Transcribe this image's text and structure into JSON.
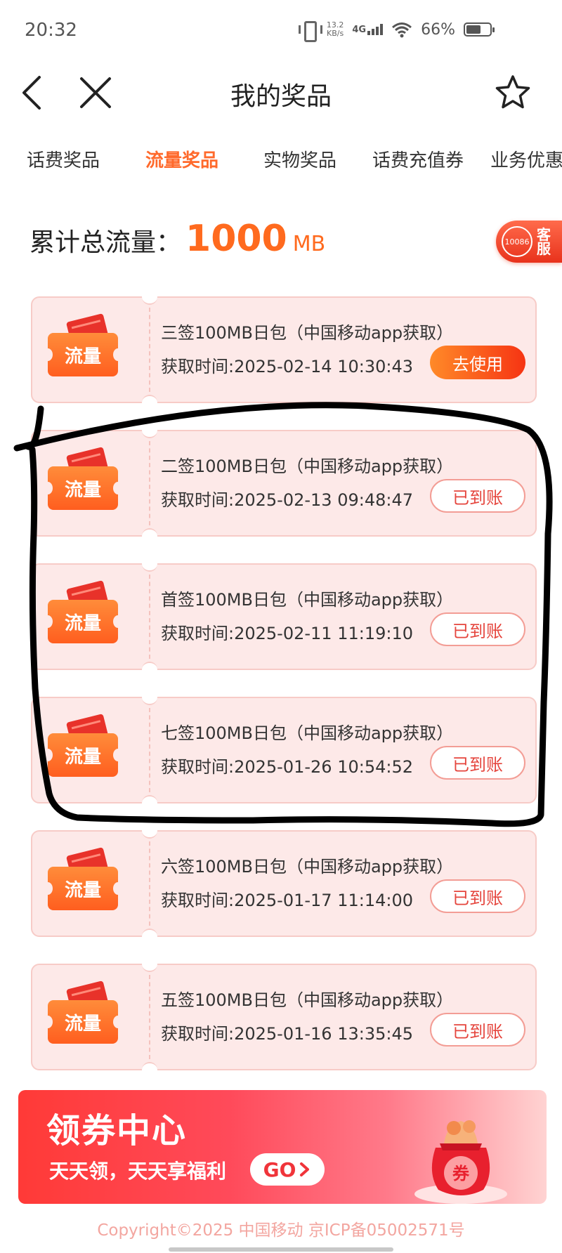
{
  "status_bar": {
    "time": "20:32",
    "net_speed_value": "13.2",
    "net_speed_unit": "KB/s",
    "network": "4G",
    "battery": "66%",
    "battery_level": 0.66
  },
  "header": {
    "title": "我的奖品",
    "back_icon": "chevron-left-icon",
    "close_icon": "close-icon",
    "favorite_icon": "star-icon"
  },
  "tabs": [
    {
      "label": "话费奖品",
      "active": false
    },
    {
      "label": "流量奖品",
      "active": true
    },
    {
      "label": "实物奖品",
      "active": false
    },
    {
      "label": "话费充值券",
      "active": false
    },
    {
      "label": "业务优惠",
      "active": false
    }
  ],
  "summary": {
    "label": "累计总流量：",
    "value": "1000",
    "unit": "MB"
  },
  "customer_service": {
    "number": "10086",
    "label": "客服"
  },
  "prizes": [
    {
      "icon_label": "流量",
      "title": "三签100MB日包（中国移动app获取）",
      "time": "获取时间:2025-02-14 10:30:43",
      "action": "去使用",
      "status": "use"
    },
    {
      "icon_label": "流量",
      "title": "二签100MB日包（中国移动app获取）",
      "time": "获取时间:2025-02-13 09:48:47",
      "action": "已到账",
      "status": "done"
    },
    {
      "icon_label": "流量",
      "title": "首签100MB日包（中国移动app获取）",
      "time": "获取时间:2025-02-11 11:19:10",
      "action": "已到账",
      "status": "done"
    },
    {
      "icon_label": "流量",
      "title": "七签100MB日包（中国移动app获取）",
      "time": "获取时间:2025-01-26 10:54:52",
      "action": "已到账",
      "status": "done"
    },
    {
      "icon_label": "流量",
      "title": "六签100MB日包（中国移动app获取）",
      "time": "获取时间:2025-01-17 11:14:00",
      "action": "已到账",
      "status": "done"
    },
    {
      "icon_label": "流量",
      "title": "五签100MB日包（中国移动app获取）",
      "time": "获取时间:2025-01-16 13:35:45",
      "action": "已到账",
      "status": "done"
    }
  ],
  "banner": {
    "title": "领券中心",
    "subtitle": "天天领，天天享福利",
    "button": "GO",
    "badge": "券"
  },
  "footer": {
    "copyright": "Copyright©2025 中国移动 京ICP备05002571号"
  },
  "colors": {
    "accent": "#ff6a2c",
    "card_bg": "#fde9e8",
    "card_border": "#f7cbc7",
    "use_button": "#f63413",
    "done_button_text": "#e5453d",
    "annotation": "#000000"
  }
}
